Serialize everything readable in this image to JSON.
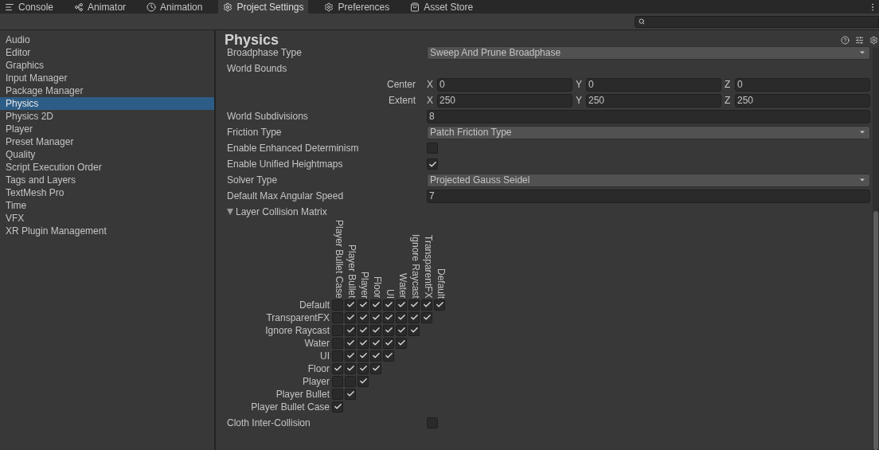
{
  "tabs": [
    {
      "label": "Console",
      "kind": "console",
      "selected": false
    },
    {
      "label": "Animator",
      "kind": "animator",
      "selected": false
    },
    {
      "label": "Animation",
      "kind": "animation",
      "selected": false
    },
    {
      "label": "Project Settings",
      "kind": "settings",
      "selected": true
    },
    {
      "label": "Preferences",
      "kind": "settings",
      "selected": false
    },
    {
      "label": "Asset Store",
      "kind": "store",
      "selected": false
    }
  ],
  "sidebar": {
    "items": [
      {
        "label": "Audio",
        "selected": false
      },
      {
        "label": "Editor",
        "selected": false
      },
      {
        "label": "Graphics",
        "selected": false
      },
      {
        "label": "Input Manager",
        "selected": false
      },
      {
        "label": "Package Manager",
        "selected": false
      },
      {
        "label": "Physics",
        "selected": true
      },
      {
        "label": "Physics 2D",
        "selected": false
      },
      {
        "label": "Player",
        "selected": false
      },
      {
        "label": "Preset Manager",
        "selected": false
      },
      {
        "label": "Quality",
        "selected": false
      },
      {
        "label": "Script Execution Order",
        "selected": false
      },
      {
        "label": "Tags and Layers",
        "selected": false
      },
      {
        "label": "TextMesh Pro",
        "selected": false
      },
      {
        "label": "Time",
        "selected": false
      },
      {
        "label": "VFX",
        "selected": false
      },
      {
        "label": "XR Plugin Management",
        "selected": false
      }
    ]
  },
  "panel": {
    "title": "Physics",
    "settings": [
      {
        "kind": "dropdown",
        "label": "Broadphase Type",
        "value": "Sweep And Prune Broadphase"
      },
      {
        "kind": "heading",
        "label": "World Bounds"
      },
      {
        "kind": "vector",
        "label": "Center",
        "axes": [
          {
            "axis": "X",
            "value": "0"
          },
          {
            "axis": "Y",
            "value": "0"
          },
          {
            "axis": "Z",
            "value": "0"
          }
        ]
      },
      {
        "kind": "vector",
        "label": "Extent",
        "axes": [
          {
            "axis": "X",
            "value": "250"
          },
          {
            "axis": "Y",
            "value": "250"
          },
          {
            "axis": "Z",
            "value": "250"
          }
        ]
      },
      {
        "kind": "number",
        "label": "World Subdivisions",
        "value": "8"
      },
      {
        "kind": "dropdown",
        "label": "Friction Type",
        "value": "Patch Friction Type"
      },
      {
        "kind": "checkbox",
        "label": "Enable Enhanced Determinism",
        "checked": false
      },
      {
        "kind": "checkbox",
        "label": "Enable Unified Heightmaps",
        "checked": true
      },
      {
        "kind": "dropdown",
        "label": "Solver Type",
        "value": "Projected Gauss Seidel"
      },
      {
        "kind": "number",
        "label": "Default Max Angular Speed",
        "value": "7"
      }
    ],
    "matrix": {
      "label": "Layer Collision Matrix",
      "expanded": true,
      "columns": [
        "Player Bullet Case",
        "Player Bullet",
        "Player",
        "Floor",
        "UI",
        "Water",
        "Ignore Raycast",
        "TransparentFX",
        "Default"
      ],
      "rows": [
        {
          "label": "Default",
          "checks": [
            false,
            true,
            true,
            true,
            true,
            true,
            true,
            true,
            true
          ]
        },
        {
          "label": "TransparentFX",
          "checks": [
            false,
            true,
            true,
            true,
            true,
            true,
            true,
            true
          ]
        },
        {
          "label": "Ignore Raycast",
          "checks": [
            false,
            true,
            true,
            true,
            true,
            true,
            true
          ]
        },
        {
          "label": "Water",
          "checks": [
            false,
            true,
            true,
            true,
            true,
            true
          ]
        },
        {
          "label": "UI",
          "checks": [
            false,
            true,
            true,
            true,
            true
          ]
        },
        {
          "label": "Floor",
          "checks": [
            true,
            true,
            true,
            true
          ]
        },
        {
          "label": "Player",
          "checks": [
            false,
            false,
            true
          ]
        },
        {
          "label": "Player Bullet",
          "checks": [
            false,
            true
          ]
        },
        {
          "label": "Player Bullet Case",
          "checks": [
            true
          ]
        }
      ]
    },
    "after": [
      {
        "kind": "checkbox",
        "label": "Cloth Inter-Collision",
        "checked": false
      }
    ]
  }
}
